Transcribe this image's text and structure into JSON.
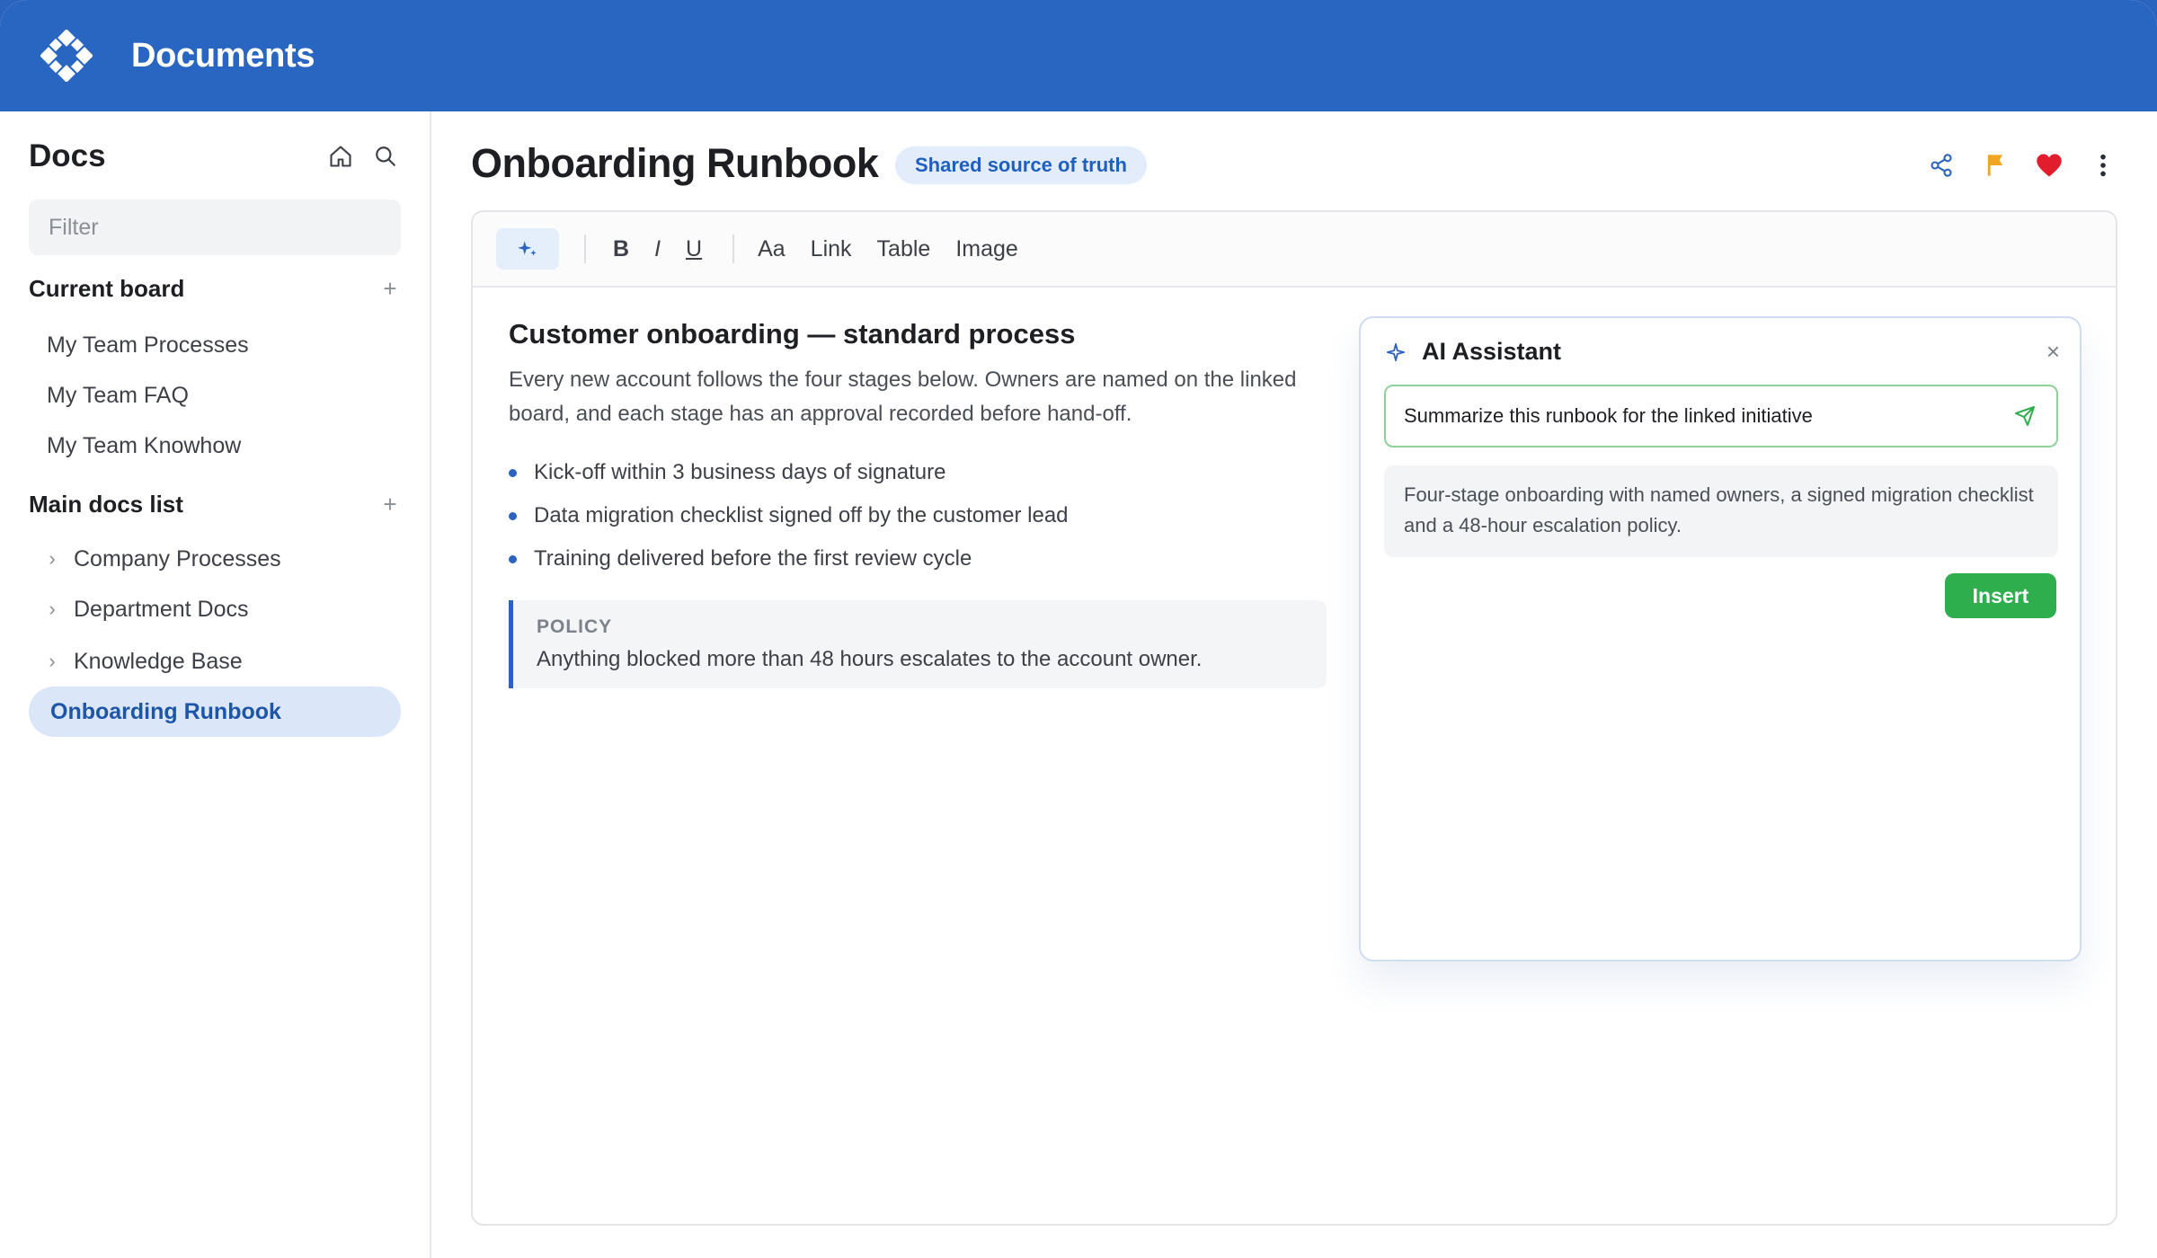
{
  "app": {
    "title": "Documents"
  },
  "sidebar": {
    "title": "Docs",
    "filter_placeholder": "Filter",
    "current_board": {
      "title": "Current board",
      "items": [
        {
          "label": "My Team Processes"
        },
        {
          "label": "My Team FAQ"
        },
        {
          "label": "My Team Knowhow"
        }
      ]
    },
    "main_docs": {
      "title": "Main docs list",
      "items": [
        {
          "label": "Company Processes"
        },
        {
          "label": "Department Docs"
        },
        {
          "label": "Knowledge Base"
        }
      ],
      "active_item": "Onboarding Runbook"
    }
  },
  "document": {
    "title": "Onboarding Runbook",
    "tag": "Shared source of truth",
    "toolbar": {
      "bold": "B",
      "italic": "I",
      "underline": "U",
      "text_style": "Aa",
      "link": "Link",
      "table": "Table",
      "image": "Image"
    },
    "heading": "Customer onboarding — standard process",
    "intro": "Every new account follows the four stages below. Owners are named on the linked board, and each stage has an approval recorded before hand-off.",
    "bullets": [
      "Kick-off within 3 business days of signature",
      "Data migration checklist signed off by the customer lead",
      "Training delivered before the first review cycle"
    ],
    "policy": {
      "label": "POLICY",
      "text": "Anything blocked more than 48 hours escalates to the account owner."
    }
  },
  "assistant": {
    "title": "AI Assistant",
    "close": "×",
    "prompt": "Summarize this runbook for the linked initiative",
    "response": "Four-stage onboarding with named owners, a signed migration checklist and a 48-hour escalation policy.",
    "insert_label": "Insert"
  },
  "colors": {
    "brand": "#2966c2",
    "accent_green": "#2fae4e",
    "flag": "#f0a623",
    "heart": "#e11d2e"
  }
}
